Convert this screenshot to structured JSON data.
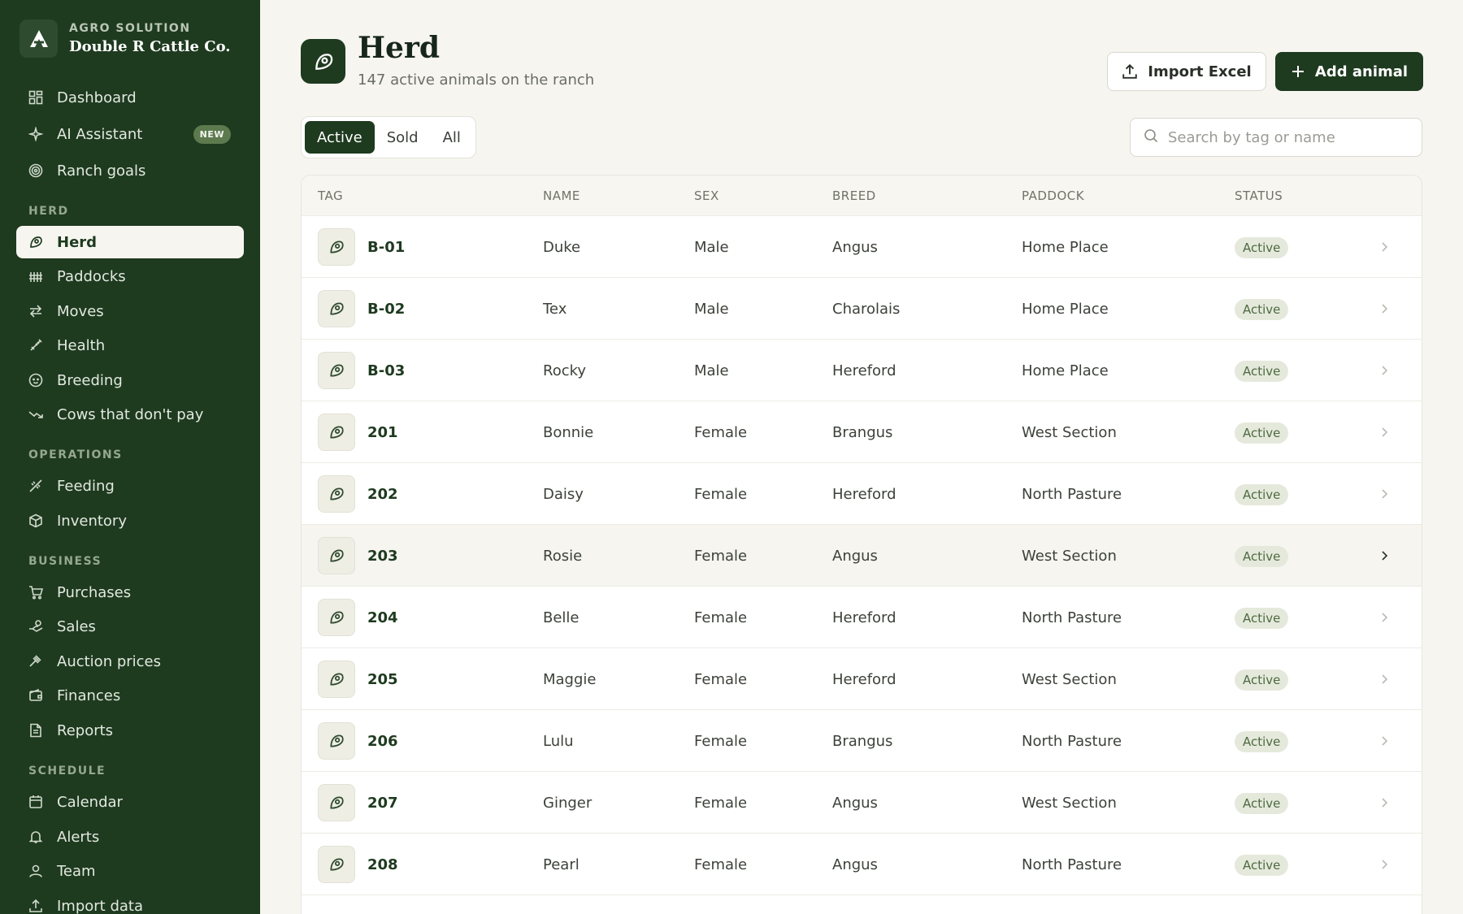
{
  "brand": {
    "subtitle": "AGRO SOLUTION",
    "name": "Double R Cattle Co."
  },
  "sidebar": {
    "top": [
      {
        "label": "Dashboard",
        "icon": "dashboard-icon"
      },
      {
        "label": "AI Assistant",
        "icon": "sparkles-icon",
        "badge": "NEW"
      },
      {
        "label": "Ranch goals",
        "icon": "target-icon"
      }
    ],
    "sections": [
      {
        "label": "HERD",
        "items": [
          "Herd",
          "Paddocks",
          "Moves",
          "Health",
          "Breeding",
          "Cows that don't pay"
        ]
      },
      {
        "label": "OPERATIONS",
        "items": [
          "Feeding",
          "Inventory"
        ]
      },
      {
        "label": "BUSINESS",
        "items": [
          "Purchases",
          "Sales",
          "Auction prices",
          "Finances",
          "Reports"
        ]
      },
      {
        "label": "SCHEDULE",
        "items": [
          "Calendar",
          "Alerts",
          "Team",
          "Import data"
        ]
      }
    ]
  },
  "header": {
    "title": "Herd",
    "subtitle": "147 active animals on the ranch",
    "import_label": "Import Excel",
    "add_label": "Add animal"
  },
  "filters": {
    "tabs": [
      "Active",
      "Sold",
      "All"
    ],
    "selected": "Active"
  },
  "search": {
    "placeholder": "Search by tag or name",
    "value": ""
  },
  "table": {
    "columns": [
      "TAG",
      "NAME",
      "SEX",
      "BREED",
      "PADDOCK",
      "STATUS"
    ],
    "rows": [
      {
        "tag": "B-01",
        "name": "Duke",
        "sex": "Male",
        "breed": "Angus",
        "paddock": "Home Place",
        "status": "Active"
      },
      {
        "tag": "B-02",
        "name": "Tex",
        "sex": "Male",
        "breed": "Charolais",
        "paddock": "Home Place",
        "status": "Active"
      },
      {
        "tag": "B-03",
        "name": "Rocky",
        "sex": "Male",
        "breed": "Hereford",
        "paddock": "Home Place",
        "status": "Active"
      },
      {
        "tag": "201",
        "name": "Bonnie",
        "sex": "Female",
        "breed": "Brangus",
        "paddock": "West Section",
        "status": "Active"
      },
      {
        "tag": "202",
        "name": "Daisy",
        "sex": "Female",
        "breed": "Hereford",
        "paddock": "North Pasture",
        "status": "Active"
      },
      {
        "tag": "203",
        "name": "Rosie",
        "sex": "Female",
        "breed": "Angus",
        "paddock": "West Section",
        "status": "Active"
      },
      {
        "tag": "204",
        "name": "Belle",
        "sex": "Female",
        "breed": "Hereford",
        "paddock": "North Pasture",
        "status": "Active"
      },
      {
        "tag": "205",
        "name": "Maggie",
        "sex": "Female",
        "breed": "Hereford",
        "paddock": "West Section",
        "status": "Active"
      },
      {
        "tag": "206",
        "name": "Lulu",
        "sex": "Female",
        "breed": "Brangus",
        "paddock": "North Pasture",
        "status": "Active"
      },
      {
        "tag": "207",
        "name": "Ginger",
        "sex": "Female",
        "breed": "Angus",
        "paddock": "West Section",
        "status": "Active"
      },
      {
        "tag": "208",
        "name": "Pearl",
        "sex": "Female",
        "breed": "Angus",
        "paddock": "North Pasture",
        "status": "Active"
      }
    ],
    "hovered_row": 5
  },
  "colors": {
    "sidebar": "#1e3a1f",
    "accent": "#1e3a1f",
    "background": "#f6f5f0",
    "status_bg": "#e5e9dc",
    "status_text": "#4d6a3f"
  }
}
